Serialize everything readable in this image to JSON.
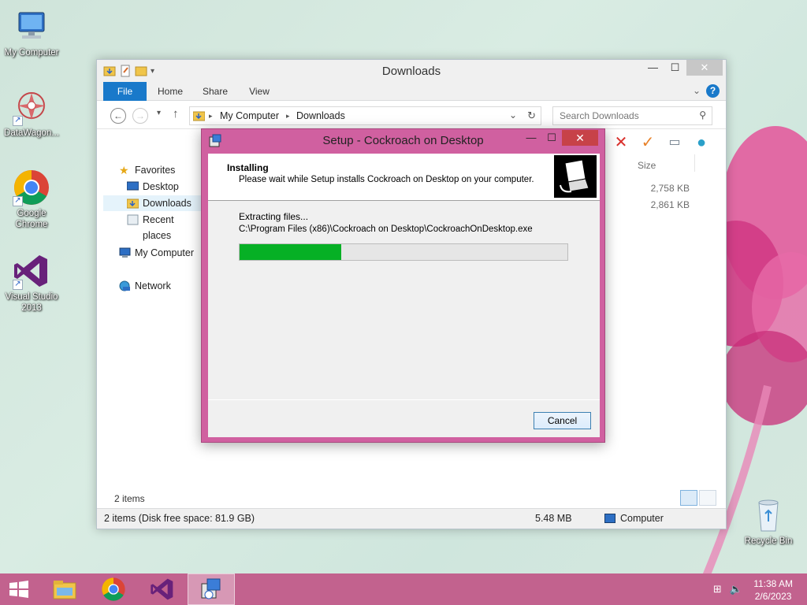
{
  "desktop": {
    "icons": [
      {
        "label": "My Computer"
      },
      {
        "label": "DataWagon..."
      },
      {
        "label": "Google Chrome"
      },
      {
        "label": "Visual Studio 2013"
      },
      {
        "label": "Recycle Bin"
      }
    ]
  },
  "explorer": {
    "title": "Downloads",
    "window_controls": {
      "minimize": "—",
      "maximize": "☐",
      "close": "✕"
    },
    "ribbon": {
      "tabs": [
        "File",
        "Home",
        "Share",
        "View"
      ],
      "help": "?"
    },
    "address": {
      "crumbs": [
        "My Computer",
        "Downloads"
      ],
      "separator": "▸"
    },
    "search": {
      "placeholder": "Search Downloads"
    },
    "nav": {
      "favorites_label": "Favorites",
      "favorites": [
        "Desktop",
        "Downloads",
        "Recent places"
      ],
      "computer_label": "My Computer",
      "network_label": "Network"
    },
    "columns": {
      "size": "Size"
    },
    "files": [
      {
        "size": "2,758 KB"
      },
      {
        "size": "2,861 KB"
      }
    ],
    "item_count": "2 items",
    "status": {
      "left": "2 items (Disk free space: 81.9 GB)",
      "size": "5.48 MB",
      "location": "Computer"
    }
  },
  "setup": {
    "title": "Setup - Cockroach on Desktop",
    "heading": "Installing",
    "subheading": "Please wait while Setup installs Cockroach on Desktop on your computer.",
    "status_label": "Extracting files...",
    "current_file": "C:\\Program Files (x86)\\Cockroach on Desktop\\CockroachOnDesktop.exe",
    "progress_fraction": 0.31,
    "cancel_label": "Cancel",
    "progress_color": "#06b025",
    "frame_color": "#d060a0"
  },
  "taskbar": {
    "time": "11:38 AM",
    "date": "2/6/2023",
    "color": "#c2628e"
  }
}
